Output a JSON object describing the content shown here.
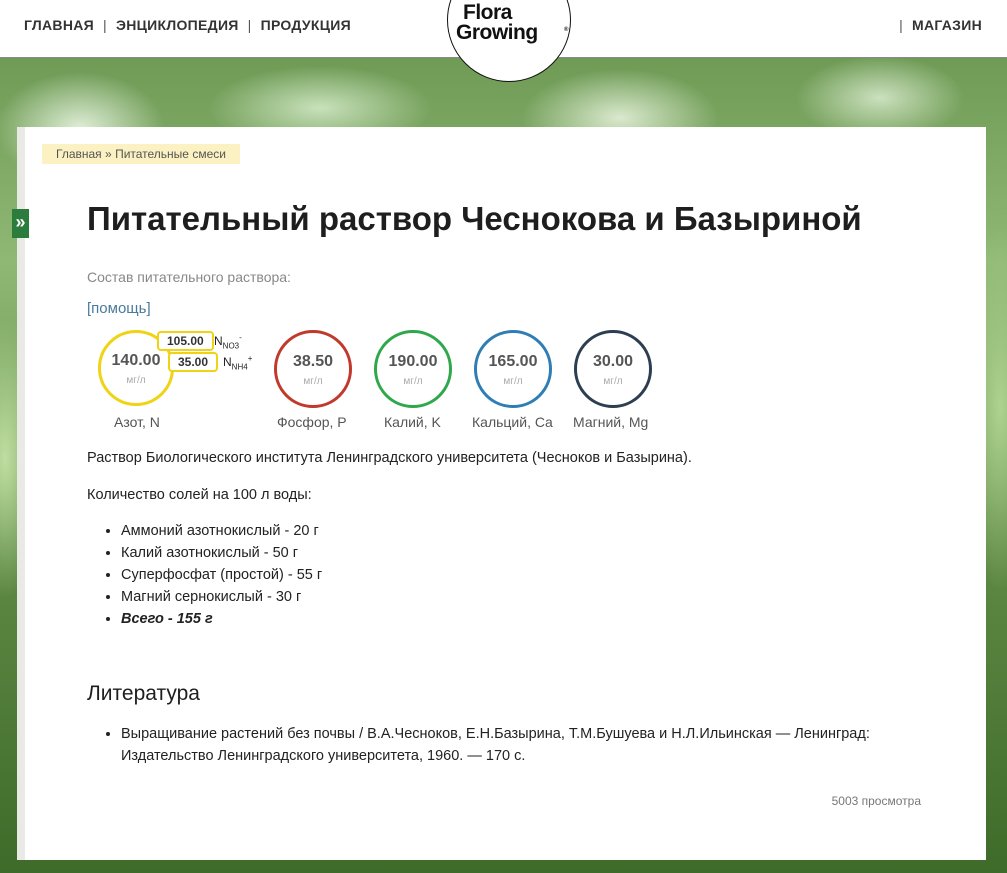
{
  "nav": {
    "left": [
      "ГЛАВНАЯ",
      "ЭНЦИКЛОПЕДИЯ",
      "ПРОДУКЦИЯ"
    ],
    "separator": "|",
    "right": "МАГАЗИН"
  },
  "logo": {
    "line1": "Flora",
    "line2": "Growing",
    "mark": "®"
  },
  "sidebar_toggle": "»",
  "breadcrumb": {
    "home": "Главная",
    "sep": "»",
    "current": "Питательные смеси"
  },
  "title": "Питательный раствор Чеснокова и Базыриной",
  "composition_label": "Состав питательного раствора:",
  "help_link": "[помощь]",
  "nutrients": [
    {
      "value": "140.00",
      "unit": "мг/л",
      "label": "Азот, N",
      "color": "#f0d315"
    },
    {
      "value": "38.50",
      "unit": "мг/л",
      "label": "Фосфор, P",
      "color": "#c0392b"
    },
    {
      "value": "190.00",
      "unit": "мг/л",
      "label": "Калий, K",
      "color": "#2ea84a"
    },
    {
      "value": "165.00",
      "unit": "мг/л",
      "label": "Кальций, Ca",
      "color": "#2e7db5"
    },
    {
      "value": "30.00",
      "unit": "мг/л",
      "label": "Магний, Mg",
      "color": "#2c3e50"
    }
  ],
  "nitrogen_forms": [
    {
      "value": "105.00",
      "symbol": "N",
      "sub": "NO",
      "sub2": "3",
      "sup": "-"
    },
    {
      "value": "35.00",
      "symbol": "N",
      "sub": "NH",
      "sub2": "4",
      "sup": "+"
    }
  ],
  "description": "Раствор Биологического института Ленинградского университета (Чесноков и Базырина).",
  "salts_heading": "Количество солей на 100 л воды:",
  "salts": [
    "Аммоний азотнокислый - 20 г",
    "Калий азотнокислый - 50 г",
    "Суперфосфат (простой) - 55 г",
    "Магний сернокислый - 30 г"
  ],
  "salts_total": "Всего - 155 г",
  "literature_heading": "Литература",
  "literature": [
    "Выращивание растений без почвы / В.А.Чесноков, Е.Н.Базырина, Т.М.Бушуева и Н.Л.Ильинская — Ленинград: Издательство Ленинградского университета, 1960. — 170 с."
  ],
  "views": "5003 просмотра"
}
